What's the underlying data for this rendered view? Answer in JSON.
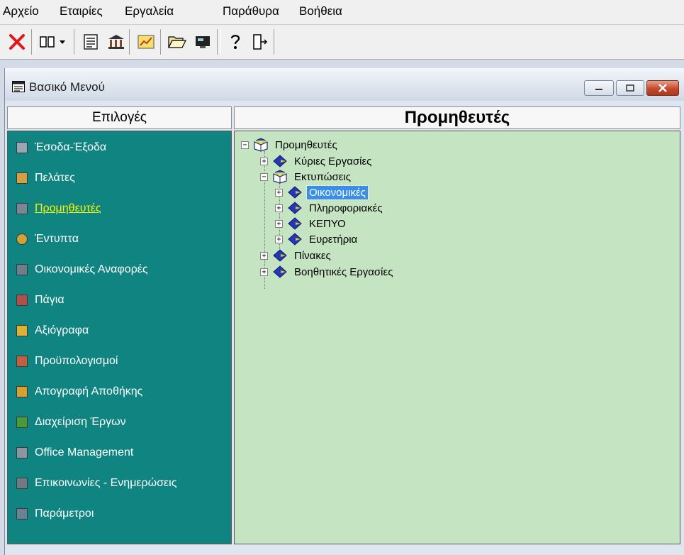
{
  "menu": [
    "Αρχείο",
    "Εταιρίες",
    "Εργαλεία",
    "Παράθυρα",
    "Βοήθεια"
  ],
  "toolbar": {
    "icons": [
      "close-icon",
      "grid-icon",
      "dropdown-arrow-icon",
      "document-icon",
      "bank-icon",
      "chart-icon",
      "folder-open-icon",
      "monitor-icon",
      "help-icon",
      "exit-icon"
    ]
  },
  "window": {
    "title": "Βασικό Μενού"
  },
  "left_panel": {
    "header": "Επιλογές",
    "items": [
      {
        "label": "Έσοδα-Έξοδα",
        "icon": "income-expense-icon",
        "color": "#9aa7b3",
        "active": false
      },
      {
        "label": "Πελάτες",
        "icon": "customers-icon",
        "color": "#d4a040",
        "active": false
      },
      {
        "label": "Προμηθευτές",
        "icon": "suppliers-icon",
        "color": "#7a8896",
        "active": true
      },
      {
        "label": "Έντυπτα",
        "icon": "forms-icon",
        "color": "#cfa23a",
        "active": false
      },
      {
        "label": "Οικονομικές Αναφορές",
        "icon": "financial-reports-icon",
        "color": "#6e7f8a",
        "active": false
      },
      {
        "label": "Πάγια",
        "icon": "fixed-assets-icon",
        "color": "#b0504a",
        "active": false
      },
      {
        "label": "Αξιόγραφα",
        "icon": "securities-icon",
        "color": "#e0b030",
        "active": false
      },
      {
        "label": "Προϋπολογισμοί",
        "icon": "budgets-icon",
        "color": "#c06040",
        "active": false
      },
      {
        "label": "Απογραφή Αποθήκης",
        "icon": "inventory-icon",
        "color": "#d8a030",
        "active": false
      },
      {
        "label": "Διαχείριση Έργων",
        "icon": "projects-icon",
        "color": "#4a9a3a",
        "active": false
      },
      {
        "label": "Office Management",
        "icon": "office-icon",
        "color": "#8a96a0",
        "active": false
      },
      {
        "label": "Επικοινωνίες - Ενημερώσεις",
        "icon": "communications-icon",
        "color": "#707a84",
        "active": false
      },
      {
        "label": "Παράμετροι",
        "icon": "parameters-icon",
        "color": "#6a8294",
        "active": false
      }
    ]
  },
  "right_panel": {
    "header": "Προμηθευτές",
    "tree": [
      {
        "label": "Προμηθευτές",
        "expanded": true,
        "icon": "open-book-icon",
        "level": 0
      },
      {
        "label": "Κύριες Εργασίες",
        "expanded": false,
        "icon": "closed-book-icon",
        "level": 1
      },
      {
        "label": "Εκτυπώσεις",
        "expanded": true,
        "icon": "open-book-icon",
        "level": 1
      },
      {
        "label": "Οικονομικές",
        "expanded": false,
        "icon": "closed-book-icon",
        "level": 2,
        "selected": true
      },
      {
        "label": "Πληροφοριακές",
        "expanded": false,
        "icon": "closed-book-icon",
        "level": 2
      },
      {
        "label": "ΚΕΠΥΟ",
        "expanded": false,
        "icon": "closed-book-icon",
        "level": 2
      },
      {
        "label": "Ευρετήρια",
        "expanded": false,
        "icon": "closed-book-icon",
        "level": 2
      },
      {
        "label": "Πίνακες",
        "expanded": false,
        "icon": "closed-book-icon",
        "level": 1
      },
      {
        "label": "Βοηθητικές Εργασίες",
        "expanded": false,
        "icon": "closed-book-icon",
        "level": 1
      }
    ]
  },
  "colors": {
    "sidebar_bg": "#0f8480",
    "tree_bg": "#c5e4c2",
    "active_item": "#f6f600",
    "selection": "#3a8ee6"
  }
}
